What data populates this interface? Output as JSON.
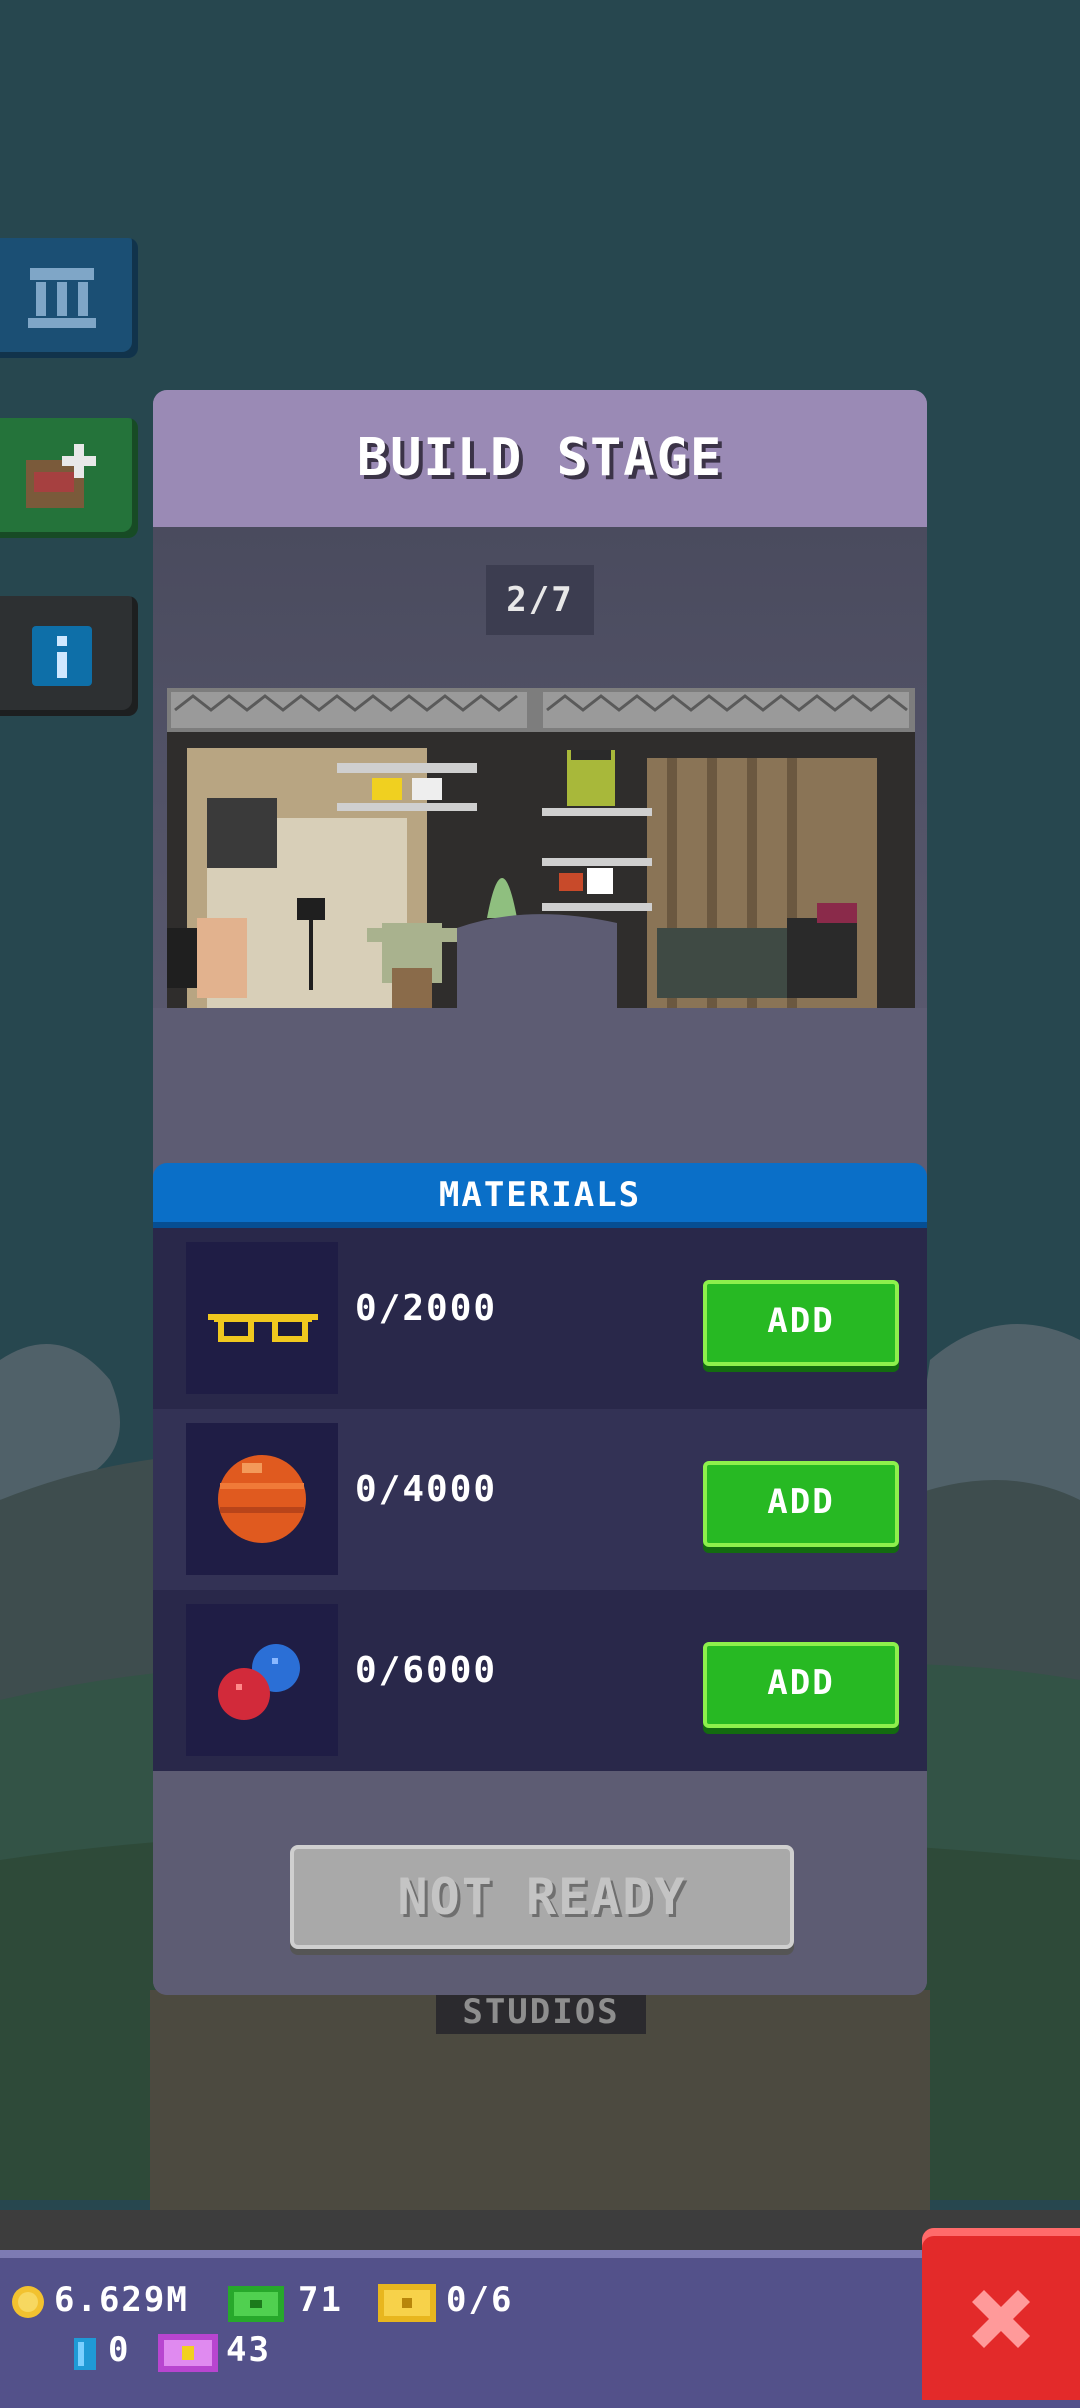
{
  "modal": {
    "title": "BUILD STAGE",
    "counter": "2/7",
    "materials_title": "MATERIALS",
    "materials": [
      {
        "icon": "sunglasses-icon",
        "quantity": "0/2000",
        "add_label": "ADD"
      },
      {
        "icon": "orange-ball-icon",
        "quantity": "0/4000",
        "add_label": "ADD"
      },
      {
        "icon": "pills-icon",
        "quantity": "0/6000",
        "add_label": "ADD"
      }
    ],
    "action_label": "NOT READY"
  },
  "background": {
    "studio_sign": "STUDIOS"
  },
  "resources": {
    "coins": "6.629M",
    "cash": "71",
    "tickets": "0/6",
    "blue_gems": "0",
    "vip": "43"
  },
  "colors": {
    "accent_blue": "#0a6fc8",
    "add_green": "#27b923",
    "close_red": "#e32a2a",
    "header_purple": "#9a8ab5"
  }
}
